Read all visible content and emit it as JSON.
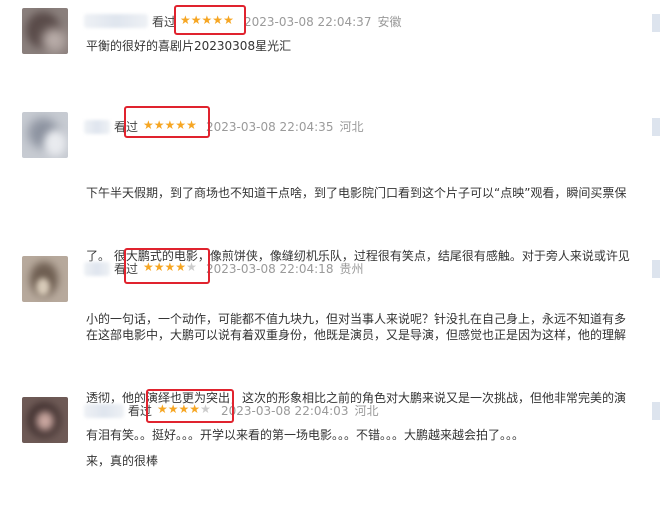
{
  "colors": {
    "star_on": "#f6a623",
    "star_off": "#cccccc",
    "highlight": "#e0232e"
  },
  "reviews": [
    {
      "watched_label": "看过",
      "rating": 5,
      "date": "2023-03-08 22:04:37",
      "location": "安徽",
      "lines": [
        "平衡的很好的喜剧片20230308星光汇"
      ]
    },
    {
      "watched_label": "看过",
      "rating": 5,
      "date": "2023-03-08 22:04:35",
      "location": "河北",
      "lines": [
        "下午半天假期，到了商场也不知道干点啥，到了电影院门口看到这个片子可以“点映”观看，瞬间买票保",
        "了。 很大鹏式的电影，像煎饼侠，像缝纫机乐队，过程很有笑点，结尾很有感触。对于旁人来说或许见",
        "小的一句话，一个动作，可能都不值九块九，但对当事人来说呢？针没扎在自己身上，永远不知道有多"
      ]
    },
    {
      "watched_label": "看过",
      "rating": 4,
      "date": "2023-03-08 22:04:18",
      "location": "贵州",
      "lines": [
        "在这部电影中，大鹏可以说有着双重身份，他既是演员，又是导演，但感觉也正是因为这样，他的理解",
        "透彻，他的演绎也更为突出，这次的形象相比之前的角色对大鹏来说又是一次挑战，但他非常完美的演",
        "来，真的很棒"
      ]
    },
    {
      "watched_label": "看过",
      "rating": 4,
      "date": "2023-03-08 22:04:03",
      "location": "河北",
      "lines": [
        "有泪有笑。。挺好。。。开学以来看的第一场电影。。。不错。。。大鹏越来越会拍了。。。"
      ]
    }
  ]
}
